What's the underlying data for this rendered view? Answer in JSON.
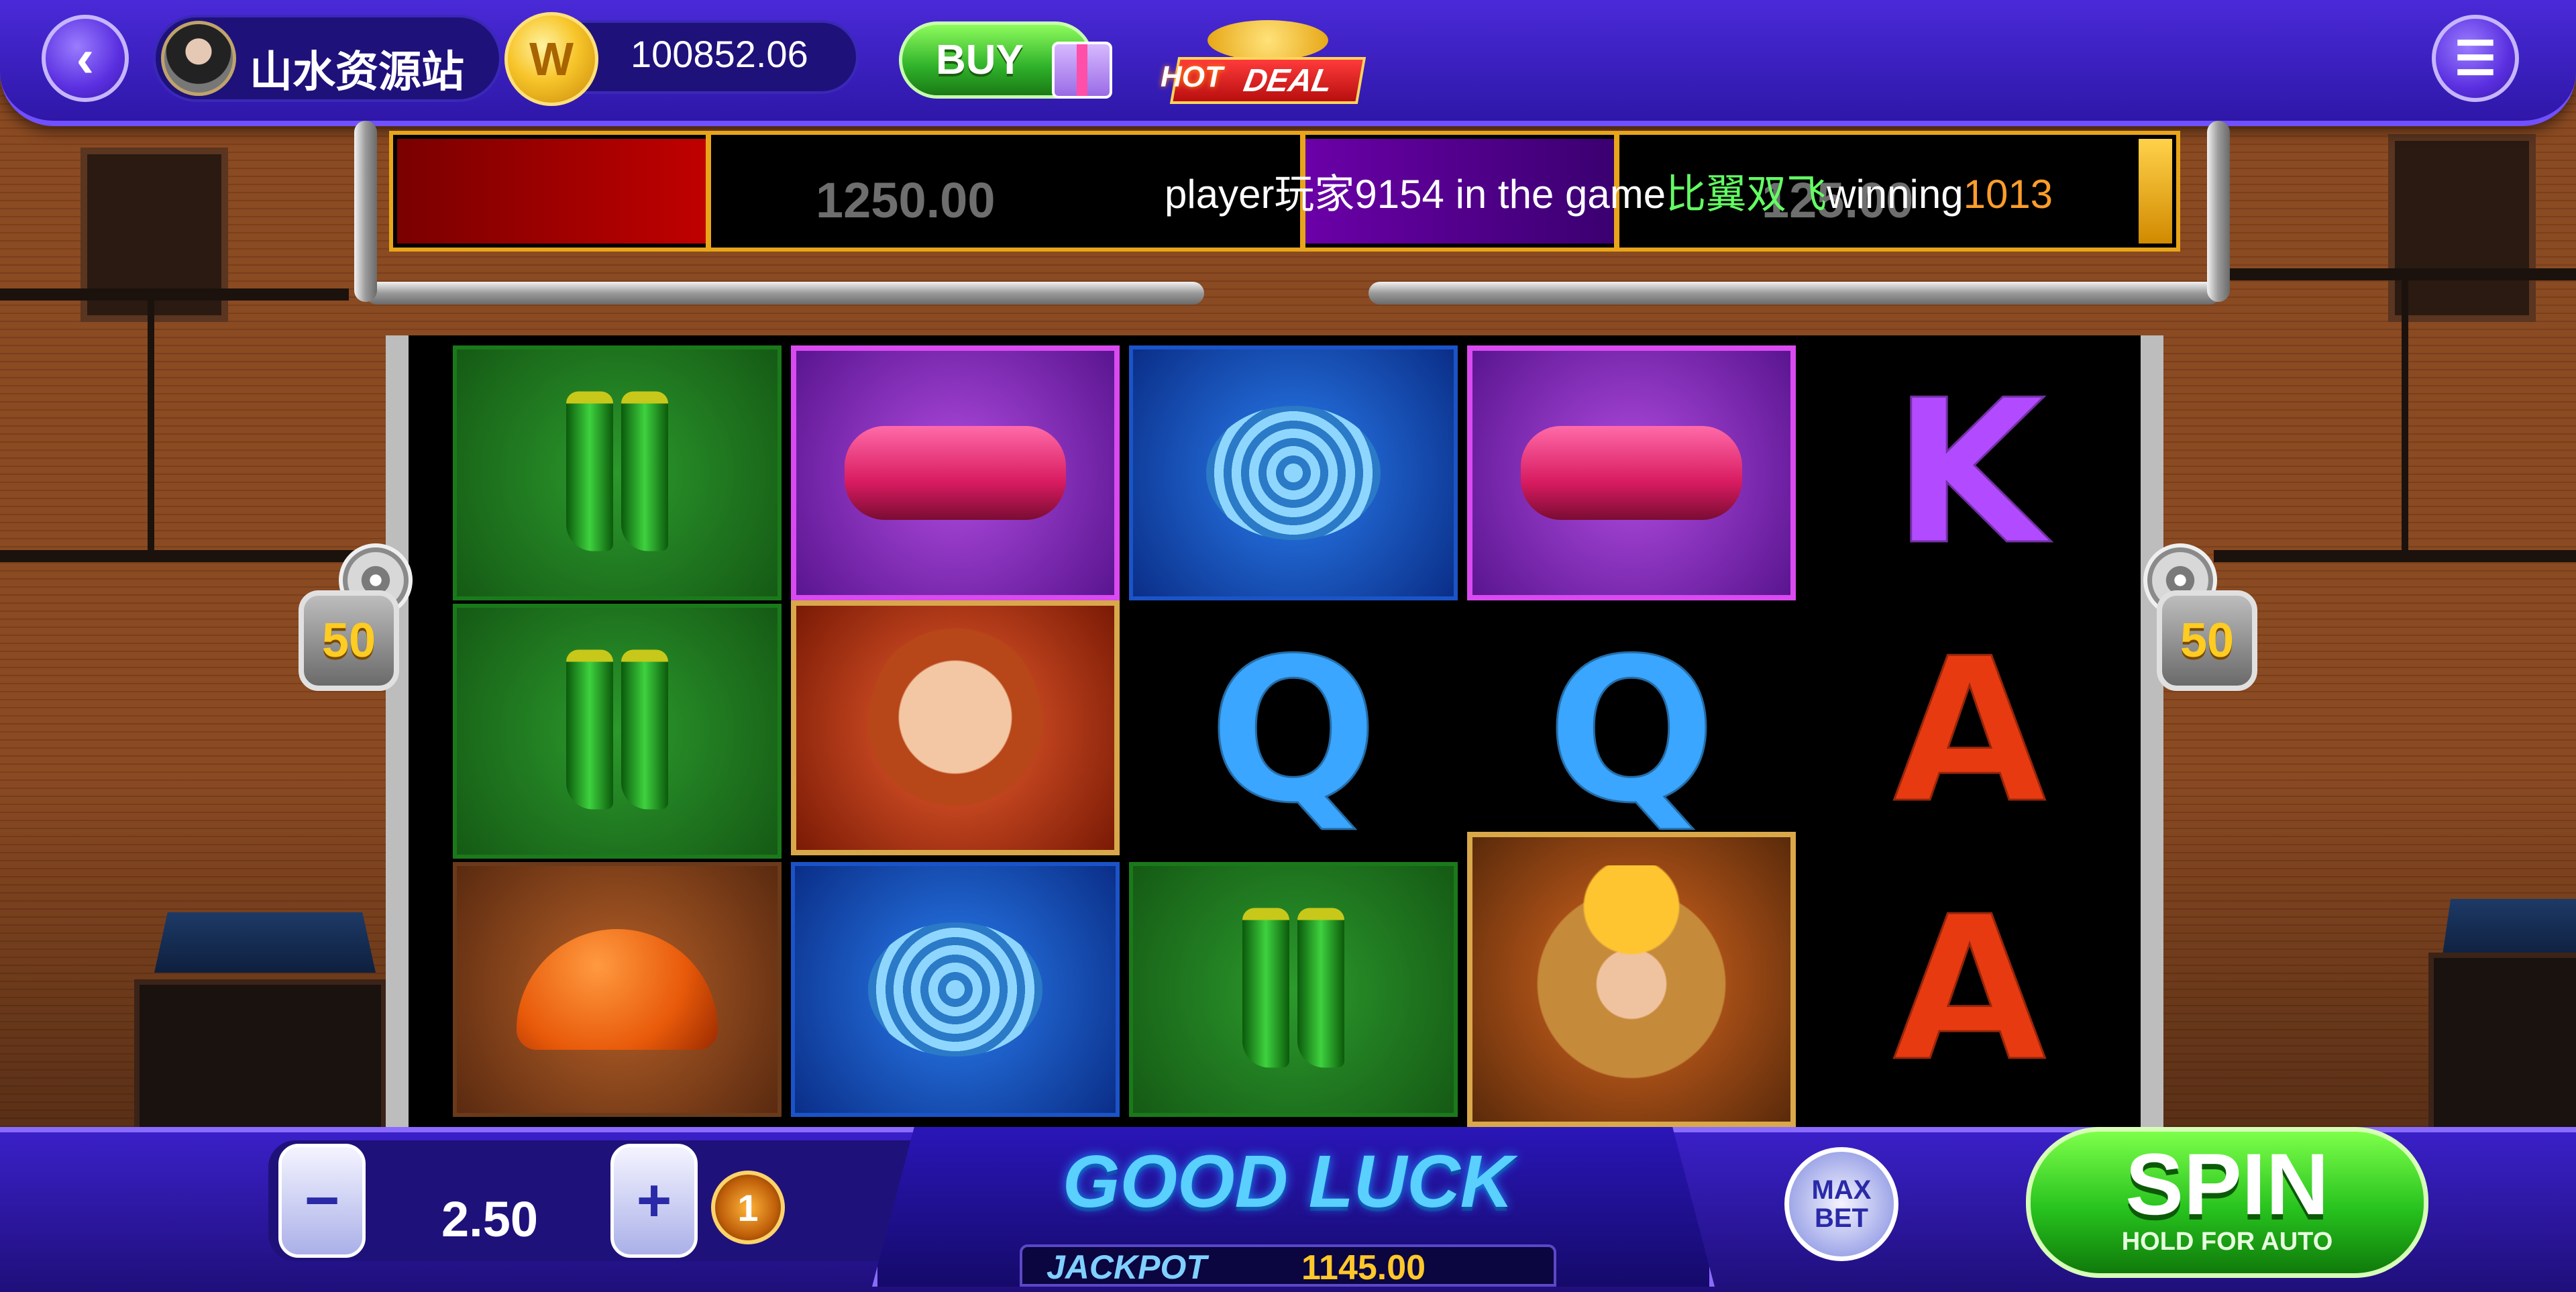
{
  "header": {
    "username": "山水资源站",
    "coin_symbol": "W",
    "balance": "100852.06",
    "buy_label": "BUY",
    "hot_label": "HOT",
    "deal_label": "DEAL"
  },
  "ticker": {
    "ghost_left": "1250.00",
    "ghost_right": "125.00",
    "msg_part1": "player玩家9154 in the game",
    "msg_game": "比翼双飞",
    "msg_part2": "winning",
    "msg_amount": "1013"
  },
  "reels": {
    "multiplier_left": "50",
    "multiplier_right": "50",
    "grid": [
      [
        "boots",
        "extinguisher",
        "hose",
        "extinguisher",
        "K"
      ],
      [
        "boots",
        "woman",
        "Q",
        "Q",
        "A"
      ],
      [
        "helmet",
        "hose",
        "boots",
        "fireman",
        "A"
      ]
    ],
    "letters": {
      "q": "Q",
      "k": "K",
      "a": "A"
    }
  },
  "controls": {
    "minus": "−",
    "plus": "+",
    "bet": "2.50",
    "level": "1",
    "status": "GOOD LUCK",
    "jackpot_label": "JACKPOT",
    "jackpot_value": "1145.00",
    "maxbet_line1": "MAX",
    "maxbet_line2": "BET",
    "spin_label": "SPIN",
    "spin_sub": "HOLD FOR AUTO"
  },
  "colors": {
    "topbar": "#3a20c8",
    "ticker_border": "#e8a51a",
    "spin": "#27c21e",
    "jackpot": "#ffc82a"
  }
}
